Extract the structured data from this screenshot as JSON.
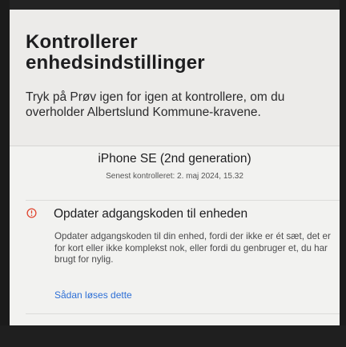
{
  "header": {
    "title_line1": "Kontrollerer",
    "title_line2": "enhedsindstillinger",
    "subtitle": "Tryk på Prøv igen for igen at kontrollere, om du overholder Albertslund Kommune-kravene."
  },
  "device": {
    "name": "iPhone SE (2nd generation)",
    "last_checked": "Senest kontrolleret: 2. maj 2024, 15.32"
  },
  "issue": {
    "icon": "exclamation-circle-icon",
    "icon_color": "#e0452f",
    "title": "Opdater adgangskoden til enheden",
    "description": "Opdater adgangskoden til din enhed, fordi der ikke er ét sæt, det er for kort eller ikke komplekst nok, eller fordi du genbruger et, du har brugt for nylig.",
    "link": "Sådan løses dette",
    "link_color": "#2d6fd6"
  }
}
